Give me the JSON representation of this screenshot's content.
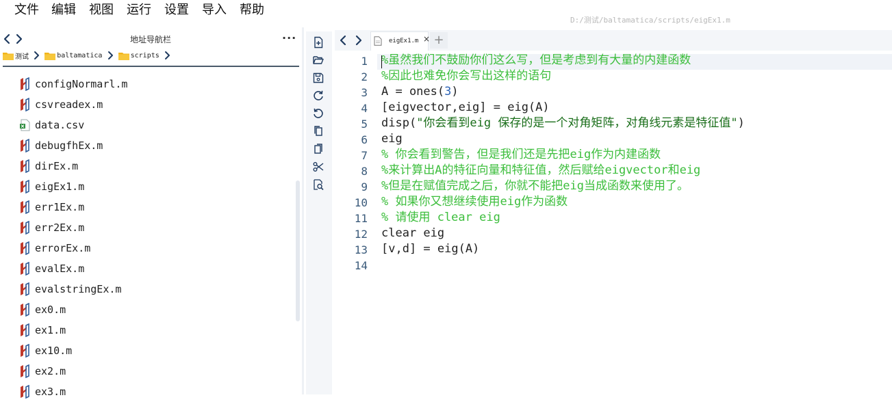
{
  "menubar": {
    "items": [
      "文件",
      "编辑",
      "视图",
      "运行",
      "设置",
      "导入",
      "帮助"
    ],
    "path_hint": "D:/测试/baltamatica/scripts/eigEx1.m"
  },
  "navigator": {
    "title": "地址导航栏",
    "more": "···",
    "breadcrumbs": [
      "测试",
      "baltamatica",
      "scripts"
    ]
  },
  "files": [
    {
      "name": "configNormarl.m",
      "type": "m"
    },
    {
      "name": "csvreadex.m",
      "type": "m"
    },
    {
      "name": "data.csv",
      "type": "csv"
    },
    {
      "name": "debugfhEx.m",
      "type": "m"
    },
    {
      "name": "dirEx.m",
      "type": "m"
    },
    {
      "name": "eigEx1.m",
      "type": "m"
    },
    {
      "name": "err1Ex.m",
      "type": "m"
    },
    {
      "name": "err2Ex.m",
      "type": "m"
    },
    {
      "name": "errorEx.m",
      "type": "m"
    },
    {
      "name": "evalEx.m",
      "type": "m"
    },
    {
      "name": "evalstringEx.m",
      "type": "m"
    },
    {
      "name": "ex0.m",
      "type": "m"
    },
    {
      "name": "ex1.m",
      "type": "m"
    },
    {
      "name": "ex10.m",
      "type": "m"
    },
    {
      "name": "ex2.m",
      "type": "m"
    },
    {
      "name": "ex3.m",
      "type": "m"
    }
  ],
  "toolbar": {
    "icons": [
      "new-file-icon",
      "open-folder-icon",
      "save-icon",
      "redo-icon",
      "undo-icon",
      "copy-icon",
      "paste-icon",
      "cut-icon",
      "find-icon"
    ]
  },
  "editor": {
    "tab_label": "eigEx1.m",
    "tab_close": "×",
    "tab_add": "+",
    "line_numbers": [
      "1",
      "2",
      "3",
      "4",
      "5",
      "6",
      "7",
      "8",
      "9",
      "10",
      "11",
      "12",
      "13",
      "14"
    ],
    "lines": [
      [
        {
          "t": "%虽然我们不鼓励你们这么写，但是考虑到有大量的内建函数",
          "c": "cmt"
        }
      ],
      [
        {
          "t": "%因此也难免你会写出这样的语句",
          "c": "cmt"
        }
      ],
      [
        {
          "t": "A = ones(",
          "c": ""
        },
        {
          "t": "3",
          "c": "num"
        },
        {
          "t": ")",
          "c": ""
        }
      ],
      [
        {
          "t": "[eigvector,eig] = eig(A)",
          "c": ""
        }
      ],
      [
        {
          "t": "disp(",
          "c": ""
        },
        {
          "t": "\"你会看到eig 保存的是一个对角矩阵，对角线元素是特征值\"",
          "c": "str"
        },
        {
          "t": ")",
          "c": ""
        }
      ],
      [
        {
          "t": "eig",
          "c": ""
        }
      ],
      [
        {
          "t": "% 你会看到警告，但是我们还是先把eig作为内建函数",
          "c": "cmt"
        }
      ],
      [
        {
          "t": "%来计算出A的特征向量和特征值，然后赋给eigvector和eig",
          "c": "cmt"
        }
      ],
      [
        {
          "t": "%但是在赋值完成之后，你就不能把eig当成函数来使用了。",
          "c": "cmt"
        }
      ],
      [
        {
          "t": "% 如果你又想继续使用eig作为函数",
          "c": "cmt"
        }
      ],
      [
        {
          "t": "% 请使用 clear eig",
          "c": "cmt"
        }
      ],
      [
        {
          "t": "clear eig",
          "c": ""
        }
      ],
      [
        {
          "t": "[v,d] = eig(A)",
          "c": ""
        }
      ],
      [
        {
          "t": "",
          "c": ""
        }
      ]
    ]
  },
  "colors": {
    "comment": "#3cbe3c",
    "string": "#1a6e1a",
    "number": "#2c63b5",
    "m_icon_red": "#c0392b",
    "m_icon_blue": "#2f5d9a",
    "folder": "#f2b51c"
  }
}
